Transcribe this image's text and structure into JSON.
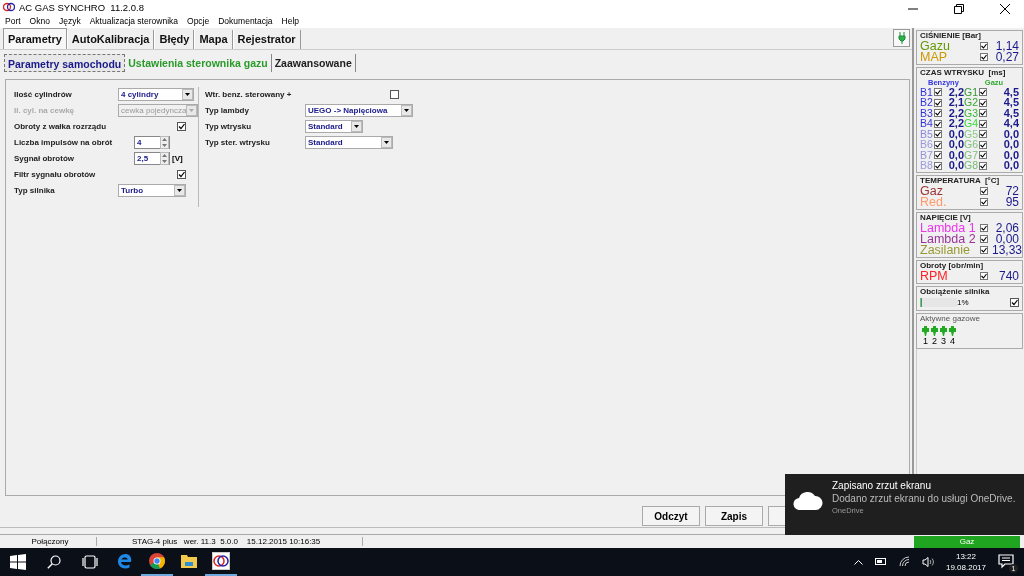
{
  "window": {
    "title": "AC GAS SYNCHRO  11.2.0.8"
  },
  "menu": [
    "Port",
    "Okno",
    "Język",
    "Aktualizacja sterownika",
    "Opcje",
    "Dokumentacja",
    "Help"
  ],
  "tabs": [
    {
      "label": "Parametry",
      "selected": true
    },
    {
      "label": "AutoKalibracja",
      "selected": false
    },
    {
      "label": "Błędy",
      "selected": false
    },
    {
      "label": "Mapa",
      "selected": false
    },
    {
      "label": "Rejestrator",
      "selected": false
    }
  ],
  "subtabs": [
    {
      "label": "Parametry samochodu",
      "selected": true,
      "color": "#1a1a8c"
    },
    {
      "label": "Ustawienia sterownika gazu",
      "selected": false,
      "color": "#2a9a2a"
    },
    {
      "label": "Zaawansowane",
      "selected": false,
      "color": "#202020"
    }
  ],
  "left_params": [
    {
      "kind": "select",
      "label": "Ilość cylindrów",
      "value": "4 cylindry",
      "disabled": false
    },
    {
      "kind": "select",
      "label": "Il. cyl. na cewkę",
      "value": "cewka pojedyncza",
      "disabled": true
    },
    {
      "kind": "checkbox",
      "label": "Obroty z wałka rozrządu",
      "checked": true,
      "disabled": false
    },
    {
      "kind": "spin",
      "label": "Liczba impulsów na obrót",
      "value": "4",
      "disabled": false
    },
    {
      "kind": "spin",
      "label": "Sygnał obrotów",
      "value": "2,5",
      "unit": "[V]",
      "disabled": false
    },
    {
      "kind": "checkbox",
      "label": "Filtr sygnału obrotów",
      "checked": true,
      "disabled": false
    },
    {
      "kind": "select",
      "label": "Typ silnika",
      "value": "Turbo",
      "disabled": false
    }
  ],
  "right_params": [
    {
      "kind": "checkbox",
      "label": "Wtr. benz. sterowany +",
      "checked": false
    },
    {
      "kind": "select",
      "label": "Typ lambdy",
      "value": "UEGO -> Napięciowa"
    },
    {
      "kind": "select",
      "label": "Typ wtrysku",
      "value": "Standard"
    },
    {
      "kind": "select",
      "label": "Typ ster. wtrysku",
      "value": "Standard"
    }
  ],
  "pressure": {
    "title": "CIŚNIENIE [Bar]",
    "rows": [
      {
        "label": "Gazu",
        "color": "#669900",
        "checked": true,
        "value": "1,14"
      },
      {
        "label": "MAP",
        "color": "#cc9900",
        "checked": true,
        "value": "0,27"
      }
    ]
  },
  "injection": {
    "title": "CZAS WTRYSKU  [ms]",
    "petrol_header": "Benzyny",
    "gas_header": "Gazu",
    "rows": [
      {
        "petrol": {
          "label": "B1",
          "color": "#3333dd",
          "checked": true,
          "value": "2,2"
        },
        "gas": {
          "label": "G1",
          "color": "#339933",
          "checked": true,
          "value": "4,5"
        }
      },
      {
        "petrol": {
          "label": "B2",
          "color": "#3333dd",
          "checked": true,
          "value": "2,1"
        },
        "gas": {
          "label": "G2",
          "color": "#33aa33",
          "checked": true,
          "value": "4,5"
        }
      },
      {
        "petrol": {
          "label": "B3",
          "color": "#3333dd",
          "checked": true,
          "value": "2,2"
        },
        "gas": {
          "label": "G3",
          "color": "#33bb33",
          "checked": true,
          "value": "4,5"
        }
      },
      {
        "petrol": {
          "label": "B4",
          "color": "#3333dd",
          "checked": true,
          "value": "2,2"
        },
        "gas": {
          "label": "G4",
          "color": "#33dd33",
          "checked": true,
          "value": "4,4"
        }
      },
      {
        "petrol": {
          "label": "B5",
          "color": "#8888dd",
          "checked": true,
          "value": "0,0"
        },
        "gas": {
          "label": "G5",
          "color": "#88cc88",
          "checked": true,
          "value": "0,0"
        }
      },
      {
        "petrol": {
          "label": "B6",
          "color": "#9999dd",
          "checked": true,
          "value": "0,0"
        },
        "gas": {
          "label": "G6",
          "color": "#80c080",
          "checked": true,
          "value": "0,0"
        }
      },
      {
        "petrol": {
          "label": "B7",
          "color": "#9393dd",
          "checked": true,
          "value": "0,0"
        },
        "gas": {
          "label": "G7",
          "color": "#7fbf7f",
          "checked": true,
          "value": "0,0"
        }
      },
      {
        "petrol": {
          "label": "B8",
          "color": "#9999dd",
          "checked": true,
          "value": "0,0"
        },
        "gas": {
          "label": "G8",
          "color": "#77bb77",
          "checked": true,
          "value": "0,0"
        }
      }
    ]
  },
  "temperature": {
    "title": "TEMPERATURA  [°C]",
    "rows": [
      {
        "label": "Gaz",
        "color": "#993333",
        "checked": true,
        "value": "72"
      },
      {
        "label": "Red.",
        "color": "#ff9966",
        "checked": true,
        "value": "95"
      }
    ]
  },
  "voltage": {
    "title": "NAPIĘCIE [V]",
    "rows": [
      {
        "label": "Lambda 1",
        "color": "#ee33ee",
        "checked": true,
        "value": "2,06"
      },
      {
        "label": "Lambda 2",
        "color": "#993399",
        "checked": true,
        "value": "0,00"
      },
      {
        "label": "Zasilanie",
        "color": "#999933",
        "checked": true,
        "value": "13,33"
      }
    ]
  },
  "rpm": {
    "title": "Obroty [obr/min]",
    "rows": [
      {
        "label": "RPM",
        "color": "#ff2222",
        "checked": true,
        "value": "740"
      }
    ]
  },
  "load": {
    "title": "Obciążenie silnika",
    "value": "1%",
    "checked": true,
    "level": 0.01
  },
  "active_injectors": {
    "title": "Aktywne gazowe",
    "items": [
      {
        "label": "1",
        "active": true
      },
      {
        "label": "2",
        "active": true
      },
      {
        "label": "3",
        "active": true
      },
      {
        "label": "4",
        "active": true
      }
    ]
  },
  "fuel_indicator": "Gaz",
  "buttons": [
    "Odczyt",
    "Zapis"
  ],
  "status_bar": [
    "Połączony",
    "STAG-4 plus   wer. 11.3  5.0.0    15.12.2015 10:16:35"
  ],
  "taskbar": {
    "apps": [
      {
        "kind": "edge",
        "running": false
      },
      {
        "kind": "chrome",
        "running": true
      },
      {
        "kind": "folder",
        "running": false
      },
      {
        "kind": "app",
        "running": true
      }
    ],
    "time": "13:22",
    "date": "19.08.2017",
    "notification_count": "1"
  },
  "notification": {
    "title": "Zapisano zrzut ekranu",
    "body": "Dodano zrzut ekranu do usługi OneDrive.",
    "source": "OneDrive"
  }
}
